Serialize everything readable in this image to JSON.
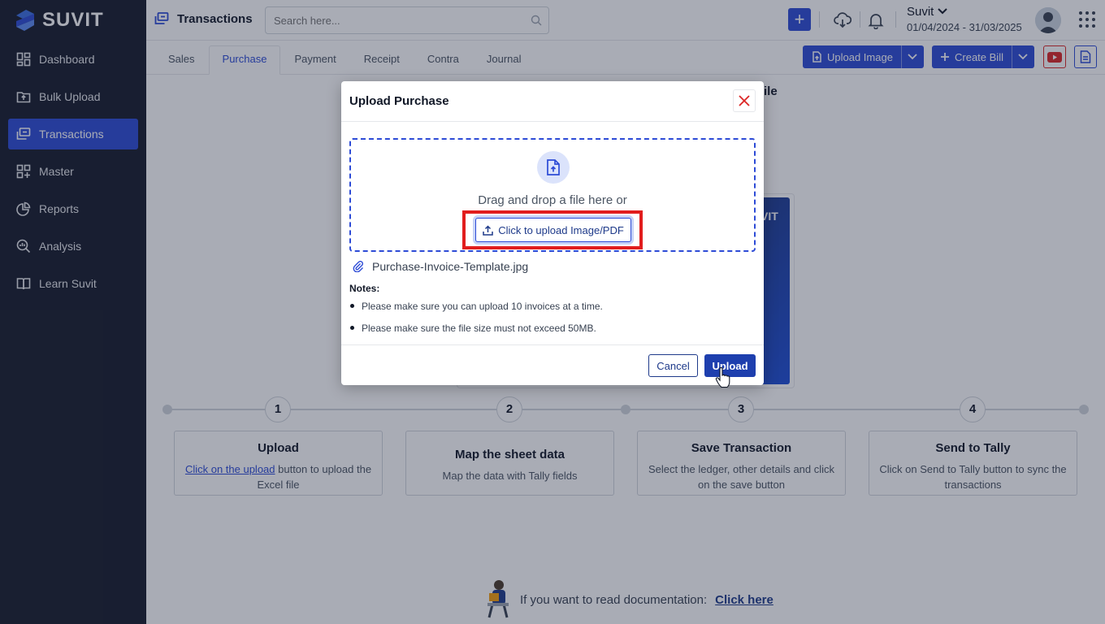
{
  "brand": {
    "name": "SUVIT",
    "accent": "#2d4bd6"
  },
  "sidebar": {
    "items": [
      {
        "label": "Dashboard",
        "icon": "dashboard-icon"
      },
      {
        "label": "Bulk Upload",
        "icon": "upload-folder-icon"
      },
      {
        "label": "Transactions",
        "icon": "transactions-icon",
        "active": true
      },
      {
        "label": "Master",
        "icon": "master-grid-icon"
      },
      {
        "label": "Reports",
        "icon": "pie-chart-icon"
      },
      {
        "label": "Analysis",
        "icon": "analysis-icon"
      },
      {
        "label": "Learn Suvit",
        "icon": "book-icon"
      }
    ]
  },
  "header": {
    "title": "Transactions",
    "search_placeholder": "Search here...",
    "company_name": "Suvit",
    "period": "01/04/2024 - 31/03/2025"
  },
  "tabs": [
    "Sales",
    "Purchase",
    "Payment",
    "Receipt",
    "Contra",
    "Journal"
  ],
  "toolbar": {
    "upload_image": "Upload Image",
    "create_bill": "Create Bill"
  },
  "background": {
    "title_fragment": "ile",
    "preview_text": "VIT",
    "steps": [
      {
        "num": "1",
        "title": "Upload",
        "link": "Click on the upload",
        "desc": " button to upload the Excel file"
      },
      {
        "num": "2",
        "title": "Map the sheet data",
        "desc": "Map the data with Tally fields"
      },
      {
        "num": "3",
        "title": "Save Transaction",
        "desc": "Select the ledger, other details and click on the save button"
      },
      {
        "num": "4",
        "title": "Send to Tally",
        "desc": "Click on Send to Tally button to sync the transactions"
      }
    ],
    "doc_text": "If you want to read documentation:",
    "doc_link": "Click here"
  },
  "modal": {
    "title": "Upload Purchase",
    "drop_text": "Drag and drop a file here or",
    "pick_button": "Click to upload Image/PDF",
    "file_name": "Purchase-Invoice-Template.jpg",
    "notes_title": "Notes:",
    "notes": [
      "Please make sure you can upload 10 invoices at a time.",
      "Please make sure the file size must not exceed 50MB."
    ],
    "cancel": "Cancel",
    "upload": "Upload"
  }
}
